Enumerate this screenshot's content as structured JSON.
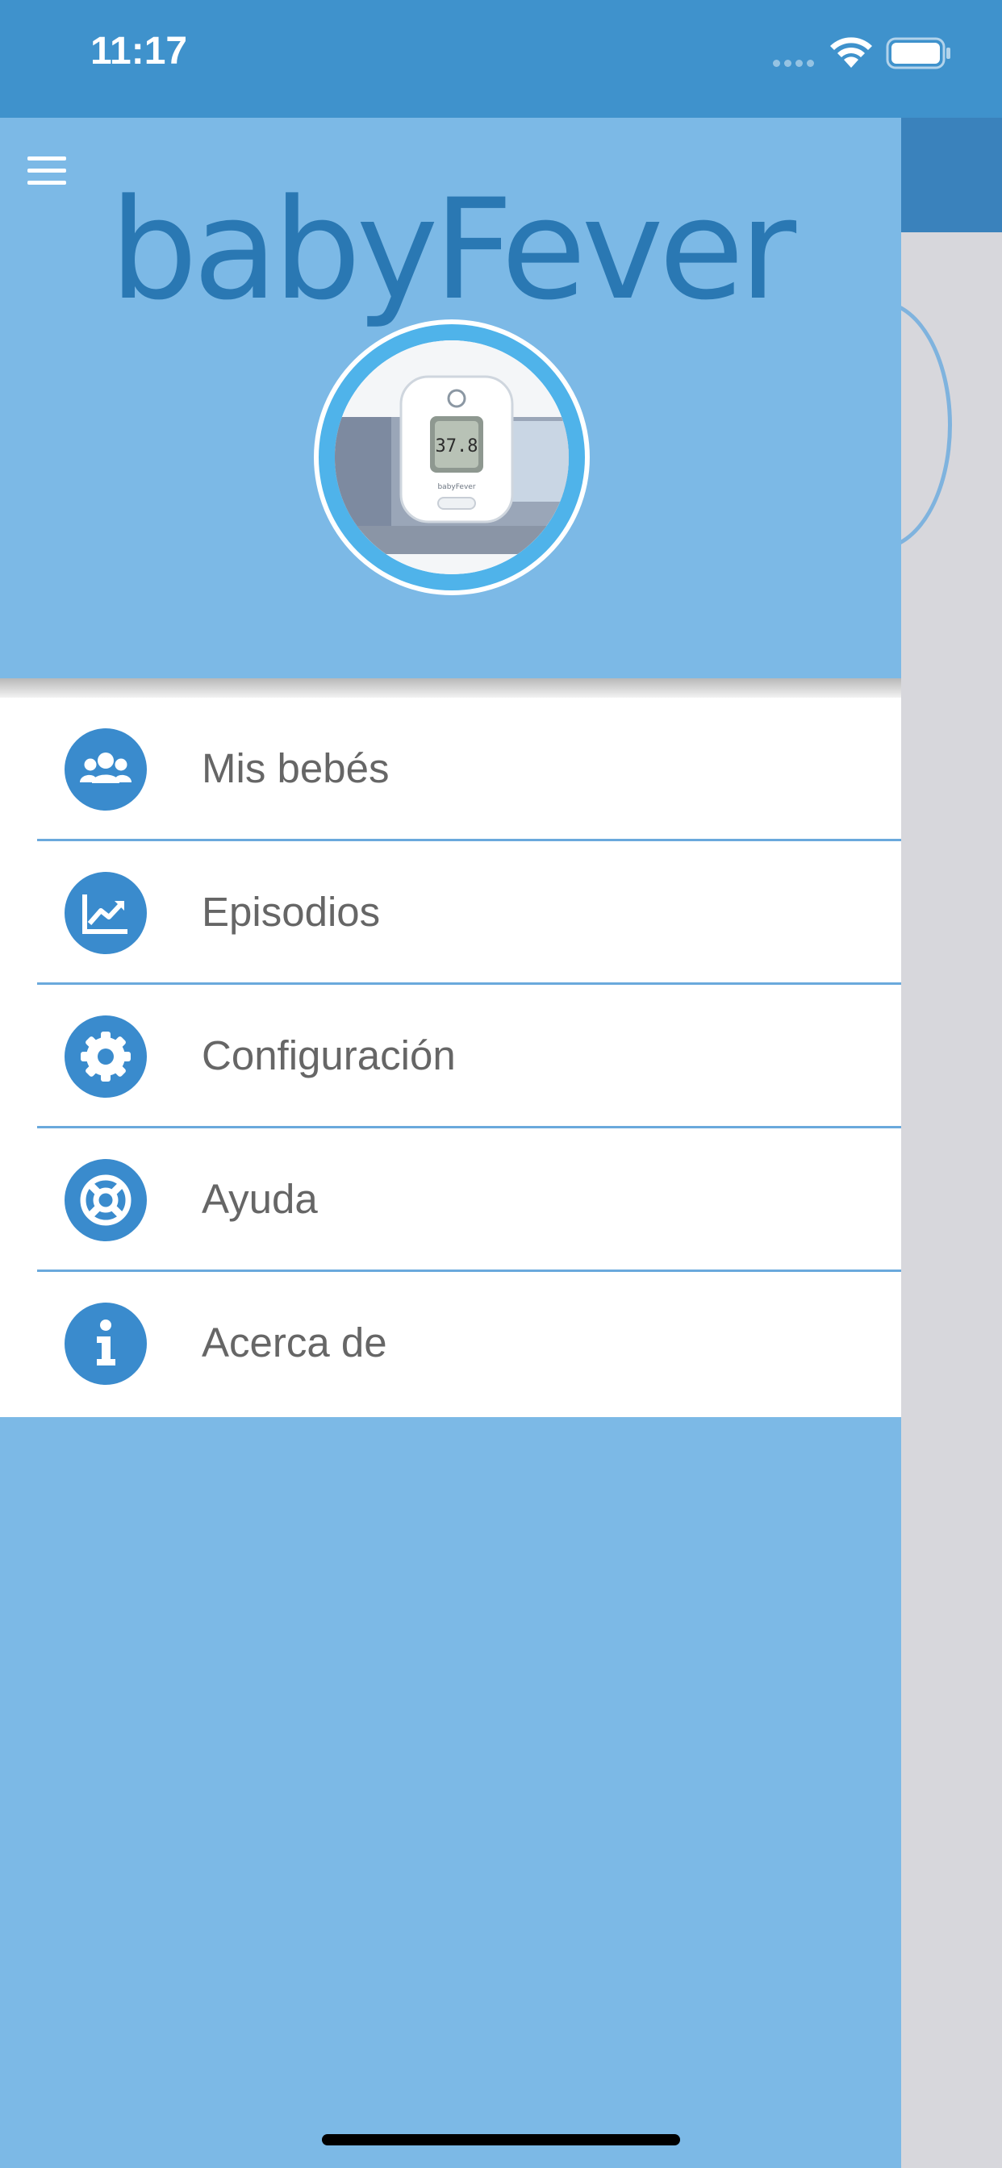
{
  "status_bar": {
    "time": "11:17",
    "background": "#3f92cc"
  },
  "drawer": {
    "brand": "babyFever",
    "menu_items": [
      {
        "label": "Mis bebés",
        "icon": "people-icon"
      },
      {
        "label": "Episodios",
        "icon": "chart-line-icon"
      },
      {
        "label": "Configuración",
        "icon": "gear-icon"
      },
      {
        "label": "Ayuda",
        "icon": "lifebuoy-icon"
      },
      {
        "label": "Acerca de",
        "icon": "info-icon"
      }
    ],
    "device_display": "37.8",
    "device_brand": "babyFever"
  },
  "colors": {
    "drawer_bg": "#7cb9e6",
    "accent": "#3a8bcd",
    "label": "#666666"
  }
}
